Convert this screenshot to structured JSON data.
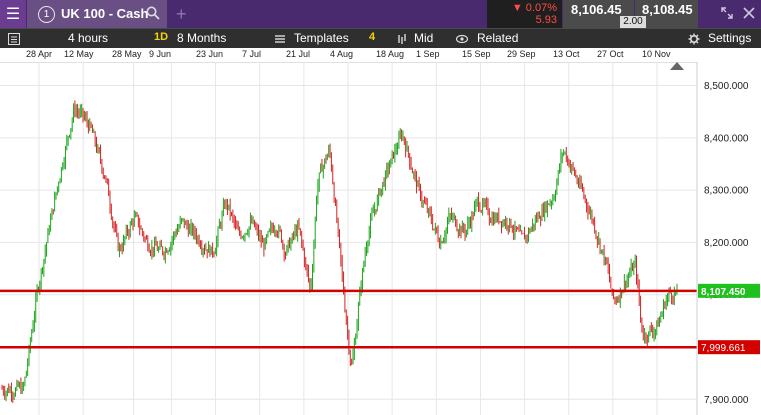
{
  "header": {
    "instrument_number": "1",
    "instrument_name": "UK 100 - Cash",
    "change_percent": "0.07%",
    "change_value": "5.93",
    "sell_price": "8,106.45",
    "buy_price": "8,108.45",
    "spread": "2.00"
  },
  "toolbar": {
    "interval": "4 hours",
    "range_badge": "1D",
    "range": "8 Months",
    "templates": "Templates",
    "templates_count": "4",
    "price_type": "Mid",
    "related": "Related",
    "settings": "Settings"
  },
  "date_axis": [
    "28 Apr",
    "12 May",
    "28 May",
    "9 Jun",
    "23 Jun",
    "7 Jul",
    "21 Jul",
    "4 Aug",
    "18 Aug",
    "1 Sep",
    "15 Sep",
    "29 Sep",
    "13 Oct",
    "27 Oct",
    "10 Nov"
  ],
  "icons": {
    "menu": "hamburger-menu-icon",
    "search": "search-icon",
    "add": "plus-icon",
    "expand": "expand-icon",
    "close": "close-icon",
    "chart_list": "chart-list-icon",
    "templates": "templates-icon",
    "mid": "price-bars-icon",
    "related": "eye-icon",
    "settings": "gear-icon",
    "scroll_marker": "scroll-triangle-icon"
  },
  "colors": {
    "header_bg": "#4a2a6e",
    "bull": "#1aa51a",
    "bear": "#d52323",
    "line_red": "#d30000",
    "current_price_label": "#20c020",
    "level_label": "#d30000"
  },
  "chart_data": {
    "type": "candlestick",
    "instrument": "UK 100 - Cash",
    "interval": "4 hours",
    "range": "8 Months",
    "x_ticks": [
      "28 Apr",
      "12 May",
      "28 May",
      "9 Jun",
      "23 Jun",
      "7 Jul",
      "21 Jul",
      "4 Aug",
      "18 Aug",
      "1 Sep",
      "15 Sep",
      "29 Sep",
      "13 Oct",
      "27 Oct",
      "10 Nov"
    ],
    "y_ticks": [
      7900,
      8000,
      8100,
      8200,
      8300,
      8400,
      8500
    ],
    "y_tick_labels": [
      "7,900.000",
      "8,000.000",
      "8,100.000",
      "8,200.000",
      "8,300.000",
      "8,400.000",
      "8,500.000"
    ],
    "ylim": [
      7870,
      8545
    ],
    "horizontal_lines": [
      8107.45,
      7999.661
    ],
    "current_price_label": "8,107.450",
    "level_label": "7,999.661",
    "approx_path": {
      "x": [
        "23 Apr",
        "27 Apr",
        "1 May",
        "5 May",
        "9 May",
        "14 May",
        "19 May",
        "23 May",
        "28 May",
        "1 Jun",
        "6 Jun",
        "12 Jun",
        "17 Jun",
        "22 Jun",
        "26 Jun",
        "30 Jun",
        "4 Jul",
        "8 Jul",
        "12 Jul",
        "15 Jul",
        "19 Jul",
        "23 Jul",
        "25 Jul",
        "29 Jul",
        "2 Aug",
        "5 Aug",
        "7 Aug",
        "10 Aug",
        "14 Aug",
        "19 Aug",
        "21 Aug",
        "26 Aug",
        "2 Sep",
        "5 Sep",
        "10 Sep",
        "14 Sep",
        "18 Sep",
        "24 Sep",
        "28 Sep",
        "3 Oct",
        "8 Oct",
        "11 Oct",
        "16 Oct",
        "20 Oct",
        "25 Oct",
        "27 Oct",
        "30 Oct",
        "3 Nov",
        "5 Nov",
        "10 Nov",
        "13 Nov",
        "17 Nov"
      ],
      "y": [
        7920,
        8100,
        8230,
        8350,
        8460,
        8420,
        8320,
        8180,
        8250,
        8200,
        8180,
        8240,
        8210,
        8180,
        8280,
        8210,
        8240,
        8190,
        8240,
        8180,
        8230,
        8100,
        8320,
        8380,
        8120,
        7950,
        8080,
        8220,
        8300,
        8380,
        8410,
        8300,
        8200,
        8250,
        8220,
        8280,
        8250,
        8240,
        8200,
        8250,
        8290,
        8380,
        8310,
        8250,
        8150,
        8080,
        8120,
        8160,
        8020,
        8040,
        8100,
        8107
      ]
    }
  }
}
